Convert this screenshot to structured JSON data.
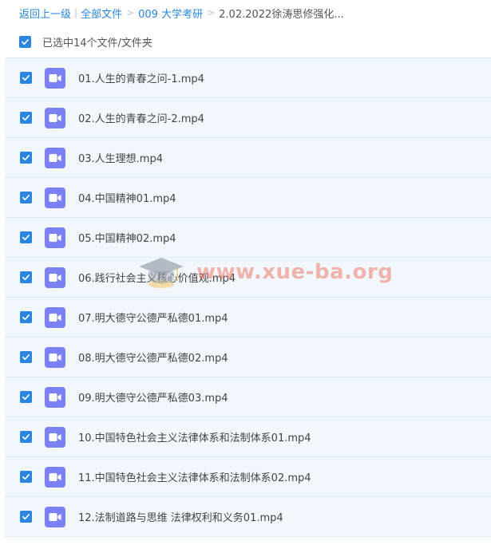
{
  "breadcrumb": {
    "back": "返回上一级",
    "sep_bar": "|",
    "sep": ">",
    "items": [
      "全部文件",
      "009 大学考研",
      "2.02.2022徐涛思修强化..."
    ]
  },
  "selection": {
    "label": "已选中14个文件/文件夹"
  },
  "files": [
    "01.人生的青春之问-1.mp4",
    "02.人生的青春之问-2.mp4",
    "03.人生理想.mp4",
    "04.中国精神01.mp4",
    "05.中国精神02.mp4",
    "06.践行社会主义核心价值观.mp4",
    "07.明大德守公德严私德01.mp4",
    "08.明大德守公德严私德02.mp4",
    "09.明大德守公德严私德03.mp4",
    "10.中国特色社会主义法律体系和法制体系01.mp4",
    "11.中国特色社会主义法律体系和法制体系02.mp4",
    "12.法制道路与思维 法律权利和义务01.mp4"
  ],
  "watermark": {
    "text": "www.xue-ba.org"
  },
  "colors": {
    "accent": "#2a86e0",
    "video_icon": "#7b81f5",
    "row_bg": "#f1f7fd"
  }
}
